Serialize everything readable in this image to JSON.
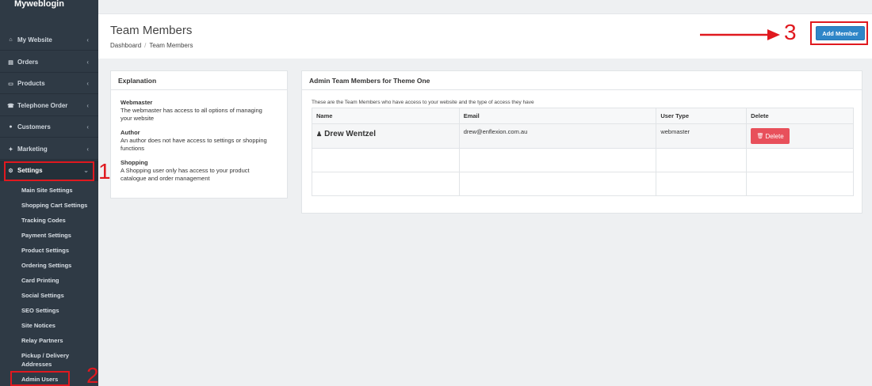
{
  "brand": "Myweblogin",
  "sidebar": {
    "items": [
      {
        "label": "My Website",
        "icon": "home-icon"
      },
      {
        "label": "Orders",
        "icon": "chart-icon"
      },
      {
        "label": "Products",
        "icon": "monitor-icon"
      },
      {
        "label": "Telephone Order",
        "icon": "phone-icon"
      },
      {
        "label": "Customers",
        "icon": "users-icon"
      },
      {
        "label": "Marketing",
        "icon": "wrench-icon"
      },
      {
        "label": "Settings",
        "icon": "gear-icon"
      }
    ],
    "sub_items": [
      "Main Site Settings",
      "Shopping Cart Settings",
      "Tracking Codes",
      "Payment Settings",
      "Product Settings",
      "Ordering Settings",
      "Card Printing",
      "Social Settings",
      "SEO Settings",
      "Site Notices",
      "Relay Partners",
      "Pickup / Delivery",
      "Addresses",
      "Admin Users"
    ]
  },
  "header": {
    "title": "Team Members",
    "breadcrumb": [
      "Dashboard",
      "/",
      "Team Members"
    ],
    "add_button": "Add Member"
  },
  "explanation": {
    "title": "Explanation",
    "terms": [
      {
        "term": "Webmaster",
        "desc": [
          "The webmaster has access to all options of managing",
          "your website"
        ]
      },
      {
        "term": "Author",
        "desc": [
          "An author does not have access to settings or shopping",
          "functions"
        ]
      },
      {
        "term": "Shopping",
        "desc": [
          "A Shopping user only has access to your product",
          "catalogue and order management"
        ]
      }
    ]
  },
  "team": {
    "title": "Admin Team Members for Theme One",
    "intro": "These are the Team Members who have access to your website and the type of access they have",
    "columns": [
      "Name",
      "Email",
      "User Type",
      "Delete"
    ],
    "rows": [
      {
        "name": "Drew Wentzel",
        "email": "drew@enflexion.com.au",
        "type": "webmaster",
        "delete": "Delete"
      }
    ]
  },
  "annotations": [
    "1",
    "2",
    "3"
  ],
  "colors": {
    "sidebar": "#2f3a45",
    "primary": "#2f86c8",
    "danger": "#e8505b",
    "annotation": "#e0191f"
  }
}
